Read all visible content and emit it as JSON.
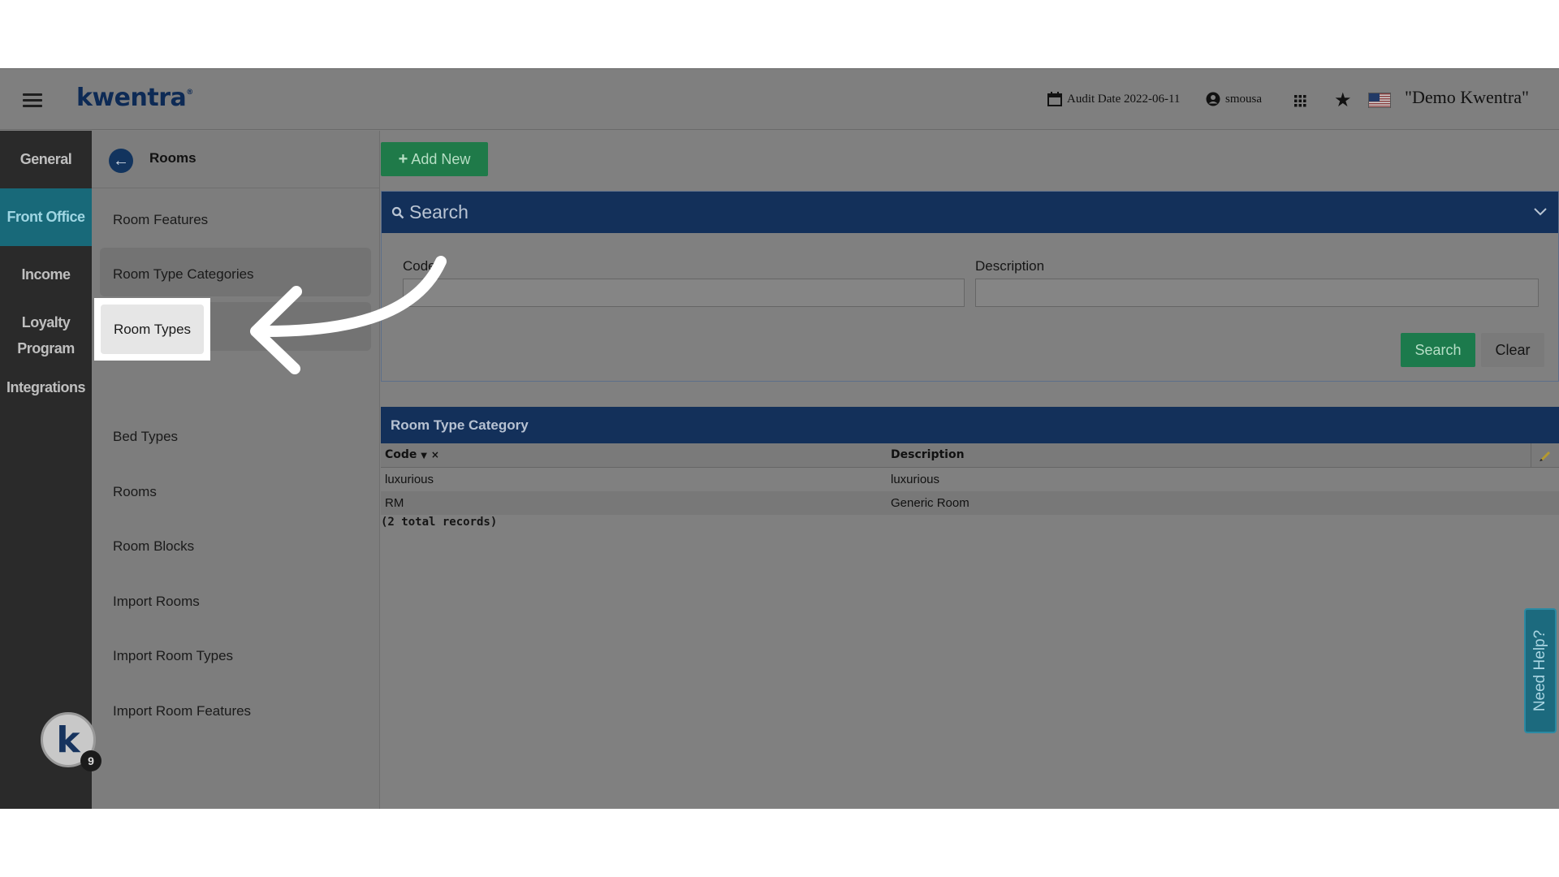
{
  "header": {
    "logo": "kwentra",
    "audit_label": "Audit Date 2022-06-11",
    "user": "smousa",
    "company": "\"Demo Kwentra\""
  },
  "rail": {
    "items": [
      "General",
      "Front Office",
      "Income",
      "Loyalty Program",
      "Integrations"
    ],
    "badge_letter": "k",
    "badge_count": "9"
  },
  "submenu": {
    "title": "Rooms",
    "items": [
      "Room Features",
      "Room Type Categories",
      "Room Types",
      "Bed Types",
      "Rooms",
      "Room Blocks",
      "Import Rooms",
      "Import Room Types",
      "Import Room Features"
    ]
  },
  "toolbar": {
    "add_new": "Add New"
  },
  "search": {
    "title": "Search",
    "code_label": "Code",
    "description_label": "Description",
    "search_button": "Search",
    "clear_button": "Clear"
  },
  "grid": {
    "title": "Room Type Category",
    "columns": [
      "Code",
      "Description"
    ],
    "rows": [
      [
        "luxurious",
        "luxurious"
      ],
      [
        "RM",
        "Generic Room"
      ]
    ],
    "total": "(2 total records)"
  },
  "help_tab": "Need Help?",
  "colors": {
    "accent_green": "#1f7a49",
    "header_navy": "#13305a",
    "active_teal": "#186979"
  },
  "icons": [
    "menu-icon",
    "calendar-icon",
    "user-icon",
    "apps-grid-icon",
    "star-icon",
    "us-flag-icon",
    "search-icon",
    "chevron-down-icon",
    "back-arrow-icon",
    "plus-icon",
    "sort-down-icon",
    "clear-filter-icon",
    "edit-pencil-icon"
  ]
}
